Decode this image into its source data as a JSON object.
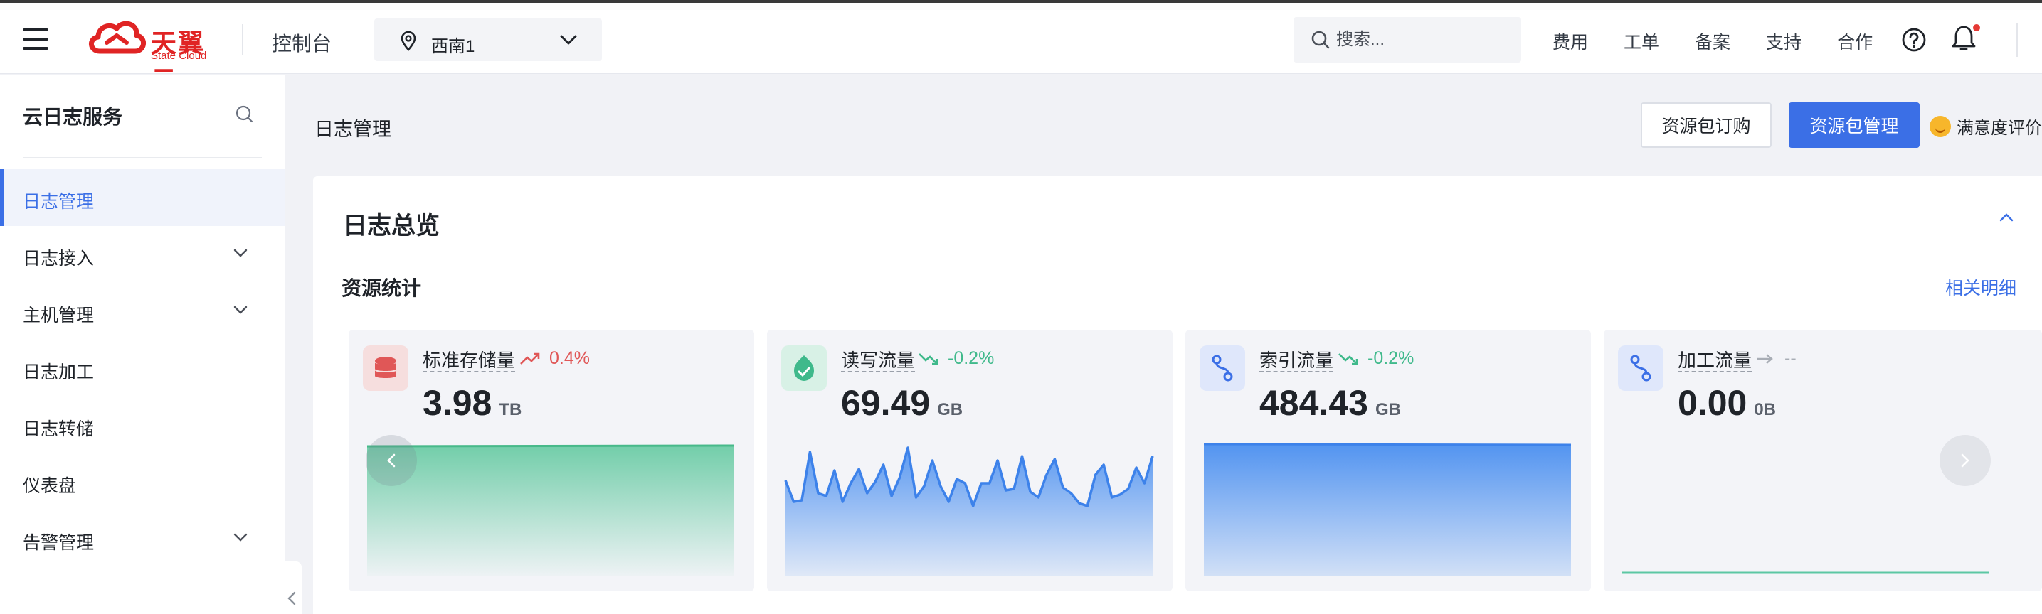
{
  "header": {
    "logo_text": "天翼云",
    "logo_sub": "State Cloud",
    "console_label": "控制台",
    "region": "西南1",
    "search_placeholder": "搜索...",
    "nav": [
      "费用",
      "工单",
      "备案",
      "支持",
      "合作"
    ],
    "icons": [
      "menu-icon",
      "location-pin-icon",
      "chevron-down-icon",
      "search-icon",
      "help-icon",
      "bell-icon"
    ]
  },
  "sidebar": {
    "title": "云日志服务",
    "items": [
      {
        "label": "日志管理",
        "active": true,
        "expandable": false
      },
      {
        "label": "日志接入",
        "active": false,
        "expandable": true
      },
      {
        "label": "主机管理",
        "active": false,
        "expandable": true
      },
      {
        "label": "日志加工",
        "active": false,
        "expandable": false
      },
      {
        "label": "日志转储",
        "active": false,
        "expandable": false
      },
      {
        "label": "仪表盘",
        "active": false,
        "expandable": false
      },
      {
        "label": "告警管理",
        "active": false,
        "expandable": true
      }
    ]
  },
  "page": {
    "title": "日志管理",
    "buttons": {
      "subscribe": "资源包订购",
      "manage": "资源包管理"
    },
    "rating": "满意度评价"
  },
  "overview": {
    "title": "日志总览",
    "section": "资源统计",
    "detail_link": "相关明细",
    "metrics": [
      {
        "name": "标准存储量",
        "change": "0.4%",
        "direction": "up",
        "value": "3.98",
        "unit": "TB",
        "color": "#e05757",
        "chart": "flat-green"
      },
      {
        "name": "读写流量",
        "change": "-0.2%",
        "direction": "down",
        "value": "69.49",
        "unit": "GB",
        "color": "#3fb98b",
        "chart": "spiky-blue"
      },
      {
        "name": "索引流量",
        "change": "-0.2%",
        "direction": "down",
        "value": "484.43",
        "unit": "GB",
        "color": "#3fb98b",
        "chart": "flat-blue"
      },
      {
        "name": "加工流量",
        "change": "--",
        "direction": "flat",
        "value": "0.00",
        "unit": "0B",
        "color": "#a8adb5",
        "chart": "zero-line"
      }
    ]
  }
}
